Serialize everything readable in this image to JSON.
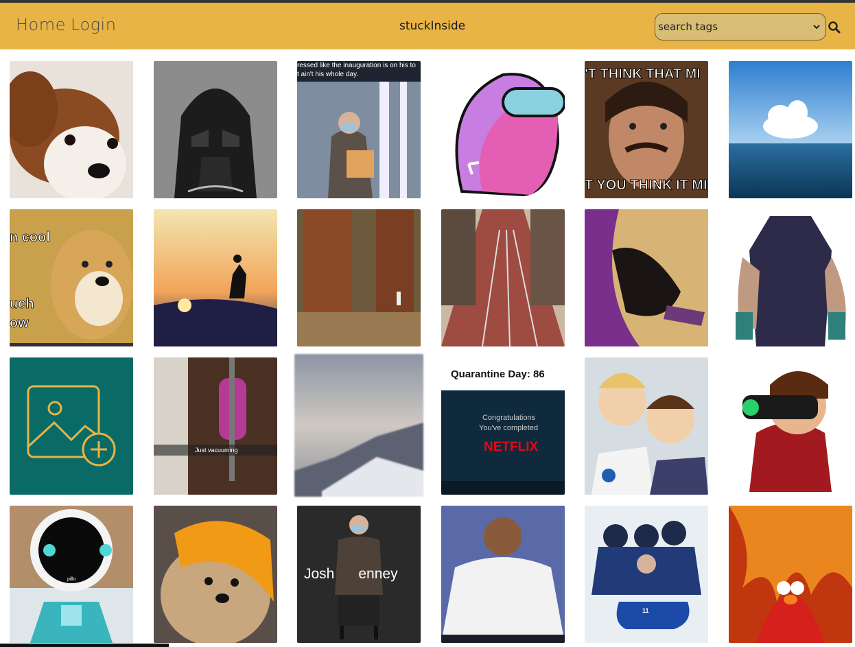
{
  "nav": {
    "home_label": "Home",
    "login_label": "Login",
    "brand": "stuckInside"
  },
  "search": {
    "placeholder_option": "search tags",
    "accent_color": "#e8b445"
  },
  "tiles": {
    "r1c3_caption": "ressed like the inauguration is on his to",
    "r1c3_caption2": "t ain't his whole day.",
    "r1c5_top": "'T THINK THAT MI",
    "r1c5_bottom": "T YOU THINK IT MI",
    "r2c1_top": "n cool",
    "r2c1_mid": "uch",
    "r2c1_bottom": "ow",
    "r3c2_caption": "Just vacuuming",
    "r3c4_title": "Quarantine Day: 86",
    "r3c4_line1": "Congratulations",
    "r3c4_line2": "You've completed",
    "r3c4_brand": "NETFLIX",
    "r4c1_label": "pillo",
    "r4c3_caption": "Josh      enney",
    "r4c5_number": "11"
  }
}
